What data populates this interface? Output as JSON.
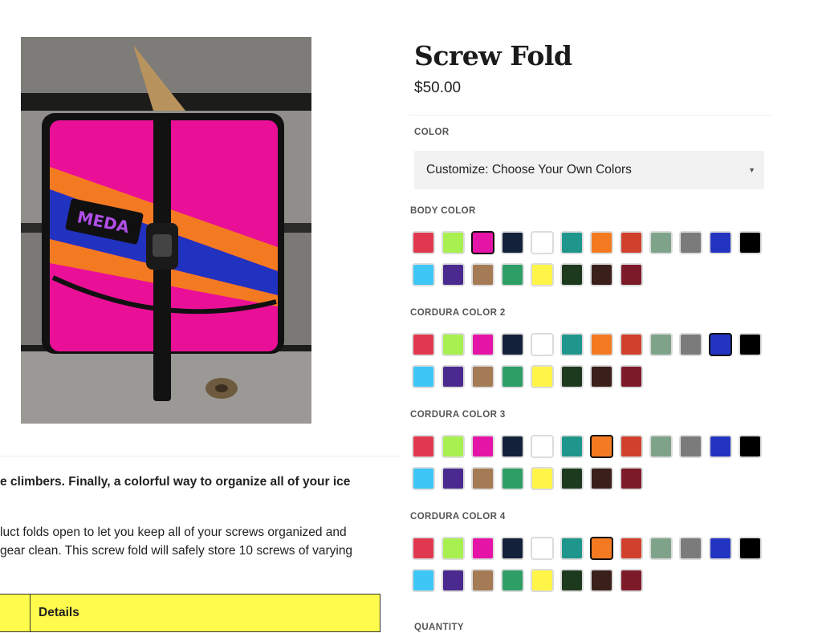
{
  "product": {
    "title": "Screw Fold",
    "price": "$50.00",
    "image_logo_text": "MEDA"
  },
  "description": {
    "lead": "e climbers. Finally, a colorful way to organize all of your ice",
    "body_line1": "luct folds open to let you keep all of your screws organized and",
    "body_line2": "gear clean. This screw fold will safely store 10 screws of varying"
  },
  "table": {
    "header": "Details"
  },
  "color": {
    "label": "COLOR",
    "selected": "Customize: Choose Your Own Colors",
    "arrow": "▼"
  },
  "palette": [
    "#e0394f",
    "#a8f04f",
    "#e514a6",
    "#14213a",
    "#ffffff",
    "#1f968c",
    "#f47a22",
    "#d0402c",
    "#7fa38a",
    "#7b7b7b",
    "#2334c0",
    "#000000",
    "#3ec6f7",
    "#4a2a8e",
    "#a47b55",
    "#2e9e66",
    "#fff548",
    "#1d3a1e",
    "#3a1f1a",
    "#7d1a2a"
  ],
  "swatch_groups": [
    {
      "label": "BODY COLOR",
      "selected": 2
    },
    {
      "label": "CORDURA COLOR 2",
      "selected": 10
    },
    {
      "label": "CORDURA COLOR 3",
      "selected": 6
    },
    {
      "label": "CORDURA COLOR 4",
      "selected": 6
    }
  ],
  "quantity": {
    "label": "QUANTITY"
  }
}
